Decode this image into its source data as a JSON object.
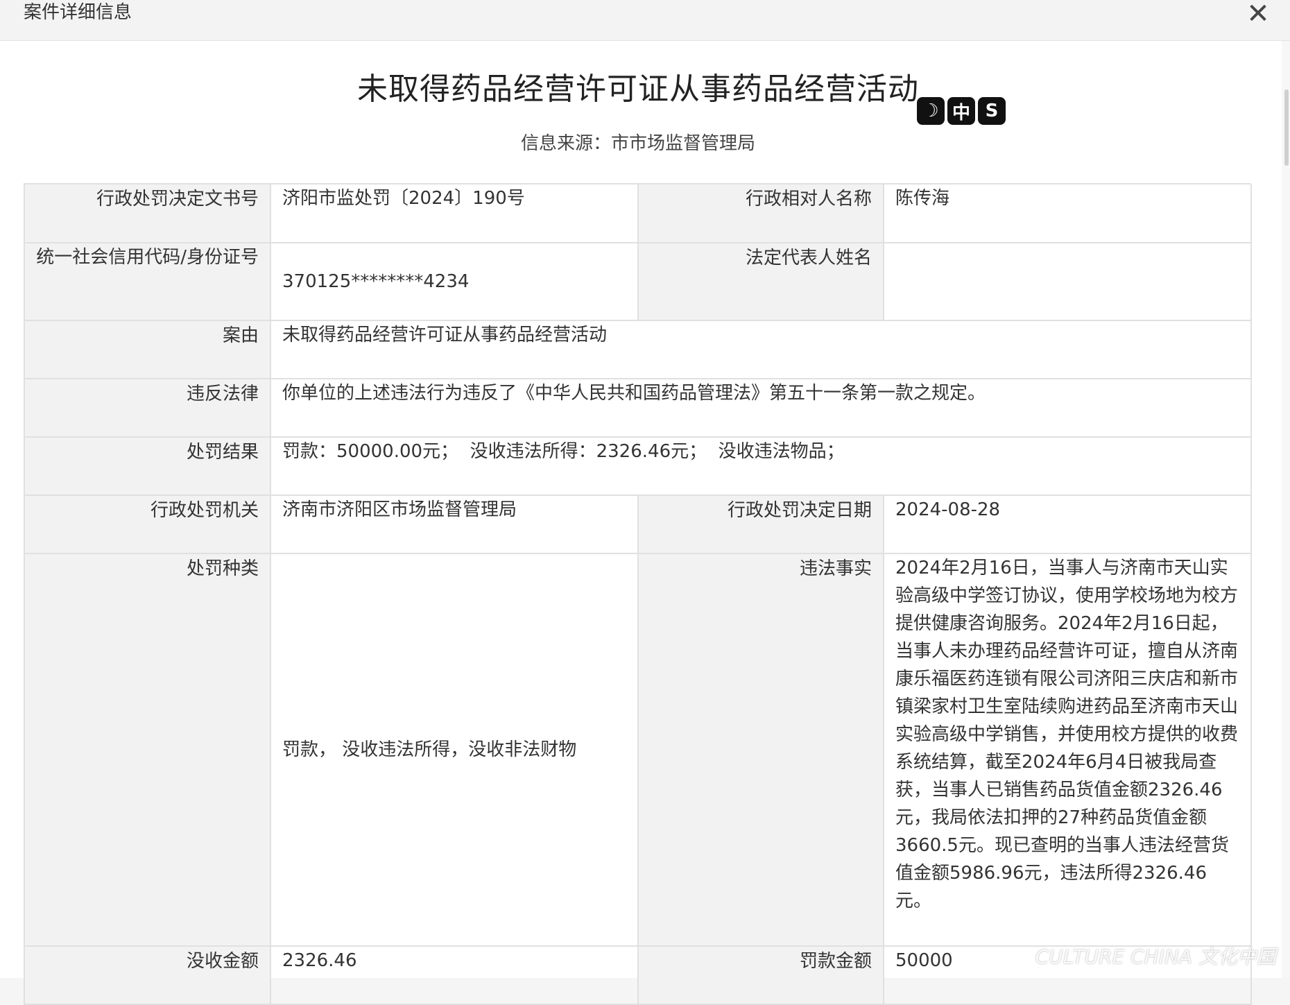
{
  "dialog": {
    "title": "案件详细信息",
    "close_glyph": "✕"
  },
  "page": {
    "title": "未取得药品经营许可证从事药品经营活动",
    "source_line": "信息来源：市市场监督管理局",
    "logo_glyphs": [
      "☽",
      "中",
      "S"
    ]
  },
  "rows": {
    "doc_no": {
      "label": "行政处罚决定文书号",
      "value": "济阳市监处罚〔2024〕190号"
    },
    "party": {
      "label": "行政相对人名称",
      "value": "陈传海"
    },
    "credit_code": {
      "label": "统一社会信用代码/身份证号",
      "value": "370125********4234"
    },
    "legal_rep": {
      "label": "法定代表人姓名",
      "value": ""
    },
    "case_reason": {
      "label": "案由",
      "value": "未取得药品经营许可证从事药品经营活动"
    },
    "violated_law": {
      "label": "违反法律",
      "value": "你单位的上述违法行为违反了《中华人民共和国药品管理法》第五十一条第一款之规定。"
    },
    "penalty_result": {
      "label": "处罚结果",
      "value": "罚款：50000.00元；  没收违法所得：2326.46元；  没收违法物品；"
    },
    "authority": {
      "label": "行政处罚机关",
      "value": "济南市济阳区市场监督管理局"
    },
    "decision_date": {
      "label": "行政处罚决定日期",
      "value": "2024-08-28"
    },
    "penalty_type": {
      "label": "处罚种类",
      "value": "罚款， 没收违法所得，没收非法财物"
    },
    "facts": {
      "label": "违法事实",
      "value": "2024年2月16日，当事人与济南市天山实验高级中学签订协议，使用学校场地为校方提供健康咨询服务。2024年2月16日起，当事人未办理药品经营许可证，擅自从济南康乐福医药连锁有限公司济阳三庆店和新市镇梁家村卫生室陆续购进药品至济南市天山实验高级中学销售，并使用校方提供的收费系统结算，截至2024年6月4日被我局查获，当事人已销售药品货值金额2326.46元，我局依法扣押的27种药品货值金额3660.5元。现已查明的当事人违法经营货值金额5986.96元，违法所得2326.46元。"
    },
    "confiscated_amount": {
      "label": "没收金额",
      "value": "2326.46"
    },
    "fine_amount": {
      "label": "罚款金额",
      "value": "50000"
    }
  },
  "watermark": "CULTURE CHINA 文化中国"
}
